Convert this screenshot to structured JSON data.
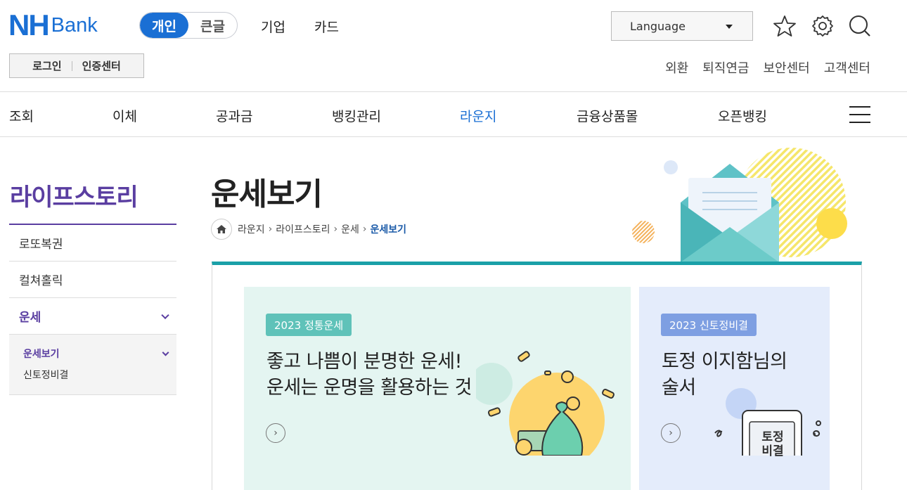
{
  "logo": {
    "nh": "NH",
    "bank": "Bank"
  },
  "segment": {
    "personal": "개인",
    "large_text": "큰글"
  },
  "top_menu": {
    "corporate": "기업",
    "card": "카드"
  },
  "language": {
    "label": "Language"
  },
  "auth": {
    "login": "로그인",
    "cert_center": "인증센터"
  },
  "util_links": [
    "외환",
    "퇴직연금",
    "보안센터",
    "고객센터"
  ],
  "gnb": {
    "items": [
      "조회",
      "이체",
      "공과금",
      "뱅킹관리",
      "라운지",
      "금융상품몰",
      "오픈뱅킹"
    ],
    "active": "라운지"
  },
  "lnb": {
    "title": "라이프스토리",
    "items": [
      "로또복권",
      "컬쳐홀릭",
      "운세"
    ],
    "sub_items": [
      "운세보기",
      "신토정비결"
    ]
  },
  "main": {
    "title": "운세보기",
    "breadcrumb": [
      "라운지",
      "라이프스토리",
      "운세",
      "운세보기"
    ]
  },
  "cards": [
    {
      "badge": "2023 정통운세",
      "lines": [
        "좋고 나쁨이 분명한 운세!",
        "운세는 운명을 활용하는 것"
      ]
    },
    {
      "badge": "2023 신토정비결",
      "lines": [
        "토정 이지함님의",
        "술서"
      ],
      "book_text": [
        "토정",
        "비결"
      ]
    }
  ],
  "colors": {
    "brand_blue": "#1a6fd4",
    "lnb_purple": "#5a3ea1",
    "teal": "#1aa0a8"
  }
}
